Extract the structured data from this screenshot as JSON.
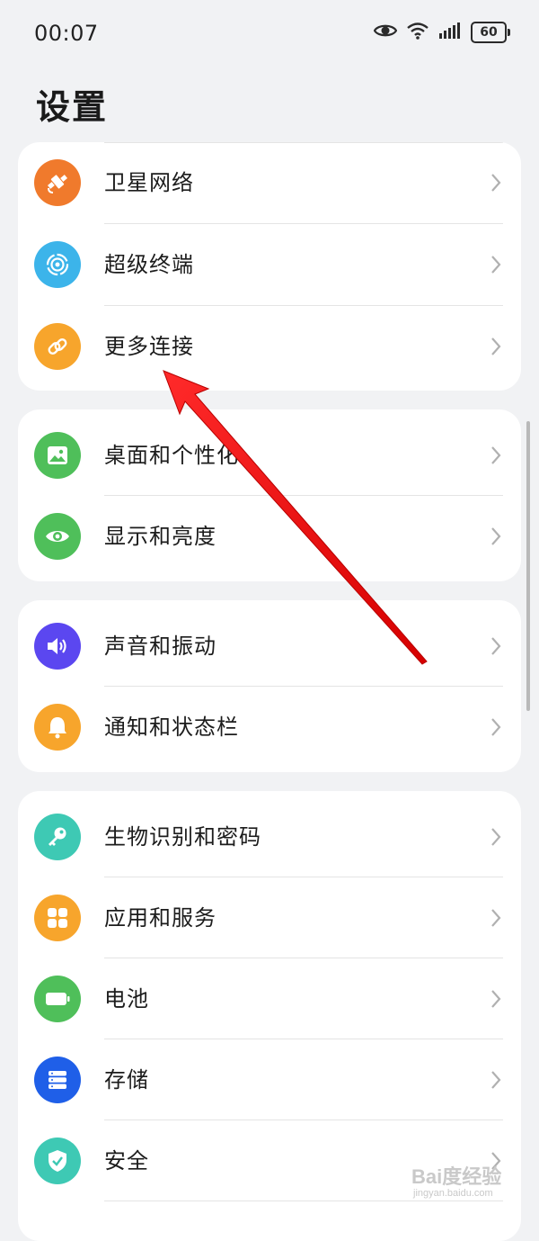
{
  "status_bar": {
    "time": "00:07",
    "battery": "60",
    "icons": [
      "eye-icon",
      "wifi-icon",
      "signal-icon",
      "battery-icon"
    ]
  },
  "page_title": "设置",
  "groups": [
    {
      "items": [
        {
          "label": "卫星网络",
          "icon": "satellite-icon",
          "color": "#f07a2c"
        },
        {
          "label": "超级终端",
          "icon": "super-device-icon",
          "color": "#3cb4ea"
        },
        {
          "label": "更多连接",
          "icon": "link-icon",
          "color": "#f7a52c"
        }
      ]
    },
    {
      "items": [
        {
          "label": "桌面和个性化",
          "icon": "wallpaper-icon",
          "color": "#4fbf5a"
        },
        {
          "label": "显示和亮度",
          "icon": "eye-icon",
          "color": "#4fbf5a"
        }
      ]
    },
    {
      "items": [
        {
          "label": "声音和振动",
          "icon": "speaker-icon",
          "color": "#5b47f0"
        },
        {
          "label": "通知和状态栏",
          "icon": "bell-icon",
          "color": "#f7a52c"
        }
      ]
    },
    {
      "items": [
        {
          "label": "生物识别和密码",
          "icon": "key-icon",
          "color": "#3ec9b4"
        },
        {
          "label": "应用和服务",
          "icon": "apps-icon",
          "color": "#f7a52c"
        },
        {
          "label": "电池",
          "icon": "battery-icon",
          "color": "#4fbf5a"
        },
        {
          "label": "存储",
          "icon": "storage-icon",
          "color": "#1f5fe8"
        },
        {
          "label": "安全",
          "icon": "shield-icon",
          "color": "#3ec9b4"
        }
      ]
    }
  ],
  "watermark": {
    "main": "Bai度经验",
    "sub": "jingyan.baidu.com"
  }
}
